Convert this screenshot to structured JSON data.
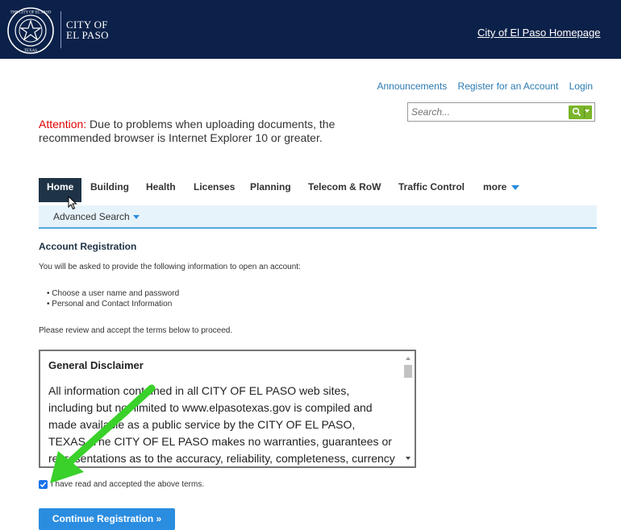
{
  "header": {
    "city_name_line1": "CITY OF",
    "city_name_line2": "EL PASO",
    "seal_text": "THE CITY OF EL PASO TEXAS",
    "homepage_link": "City of El Paso Homepage"
  },
  "utility_links": [
    "Announcements",
    "Register for an Account",
    "Login"
  ],
  "search": {
    "placeholder": "Search..."
  },
  "notice": {
    "label": "Attention:",
    "text": "Due to problems when uploading documents, the recommended browser is Internet Explorer 10 or greater."
  },
  "nav": {
    "tabs": [
      "Home",
      "Building",
      "Health",
      "Licenses",
      "Planning",
      "Telecom & RoW",
      "Traffic Control",
      "more"
    ],
    "active": "Home",
    "sub_item": "Advanced Search"
  },
  "main": {
    "title": "Account Registration",
    "intro": "You will be asked to provide the following information to open an account:",
    "bullets": [
      "• Choose a user name and password",
      "• Personal and Contact Information"
    ],
    "review": "Please review and accept the terms below to proceed.",
    "terms_title": "General Disclaimer",
    "terms_body": "All information contained in all CITY OF EL PASO web sites, including but not limited to www.elpasotexas.gov is compiled and made available as a public service by the CITY OF EL PASO, TEXAS. The CITY OF EL PASO makes no warranties, guarantees or representations as to the accuracy, reliability, completeness, currency or suitability of the",
    "agree_label": "I have read and accepted the above terms.",
    "agree_checked": true,
    "continue_label": "Continue Registration »"
  },
  "colors": {
    "header_bg": "#0c2149",
    "link": "#2a7ab0",
    "attention": "#e00000",
    "search_button": "#7ab52a",
    "primary_button": "#2b8de0",
    "arrow": "#39d12a"
  }
}
